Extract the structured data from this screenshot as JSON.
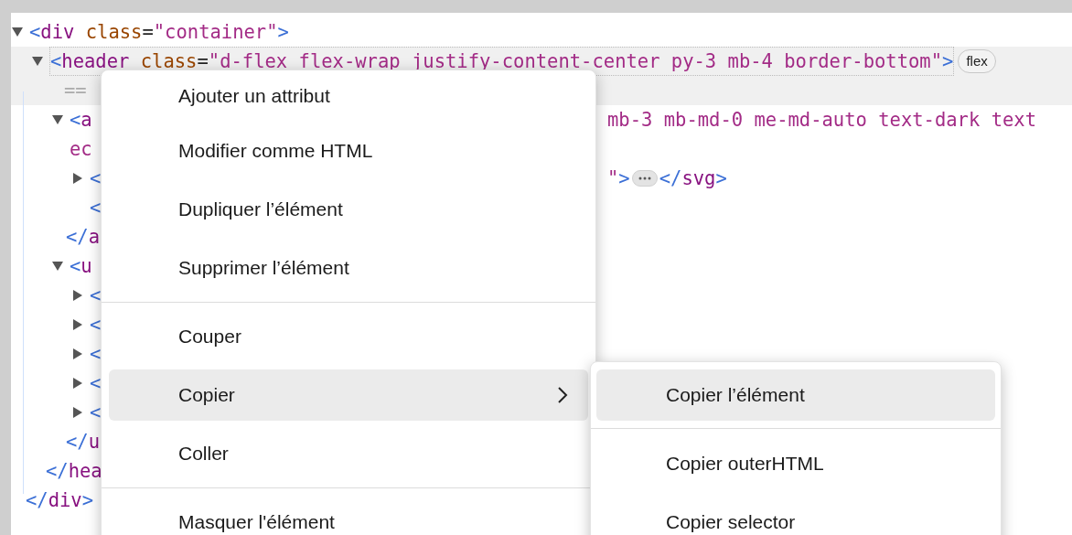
{
  "dom_tree": [
    {
      "expanded": true,
      "selected": false,
      "open": [
        {
          "kind": "bracket",
          "text": "<"
        },
        {
          "kind": "tag",
          "text": "div"
        },
        {
          "kind": "attr",
          "text": " class"
        },
        {
          "kind": "plain",
          "text": "="
        },
        {
          "kind": "value",
          "text": "\"container\""
        },
        {
          "kind": "bracket",
          "text": ">"
        }
      ],
      "close": [
        {
          "kind": "bracket",
          "text": "</"
        },
        {
          "kind": "tag",
          "text": "div"
        },
        {
          "kind": "bracket",
          "text": ">"
        }
      ],
      "children": [
        {
          "expanded": true,
          "selected": true,
          "badge": "flex",
          "marker": "==",
          "open": [
            {
              "kind": "bracket",
              "text": "<"
            },
            {
              "kind": "tag",
              "text": "header"
            },
            {
              "kind": "attr",
              "text": " class"
            },
            {
              "kind": "plain",
              "text": "="
            },
            {
              "kind": "value",
              "text": "\"d-flex flex-wrap justify-content-center py-3 mb-4 border-bottom\""
            },
            {
              "kind": "bracket",
              "text": ">"
            }
          ],
          "close": [
            {
              "kind": "bracket",
              "text": "</"
            },
            {
              "kind": "tag",
              "text": "hea"
            }
          ],
          "children": [
            {
              "expanded": true,
              "selected": false,
              "open": [
                {
                  "kind": "bracket",
                  "text": "<"
                },
                {
                  "kind": "tag",
                  "text": "a"
                }
              ],
              "right": [
                {
                  "kind": "value",
                  "text": "mb-3 mb-md-0 me-md-auto text-dark text"
                }
              ],
              "continuation": [
                {
                  "kind": "value",
                  "text": "ec"
                }
              ],
              "close": [
                {
                  "kind": "bracket",
                  "text": "</"
                },
                {
                  "kind": "tag",
                  "text": "a"
                }
              ],
              "children": [
                {
                  "expanded": false,
                  "selected": false,
                  "open": [
                    {
                      "kind": "bracket",
                      "text": "<"
                    }
                  ],
                  "right": [
                    {
                      "kind": "value",
                      "text": "\""
                    },
                    {
                      "kind": "bracket",
                      "text": ">"
                    },
                    {
                      "kind": "ellipsis"
                    },
                    {
                      "kind": "bracket",
                      "text": "</"
                    },
                    {
                      "kind": "tag",
                      "text": "svg"
                    },
                    {
                      "kind": "bracket",
                      "text": ">"
                    }
                  ]
                },
                {
                  "selected": false,
                  "open": [
                    {
                      "kind": "bracket",
                      "text": "<"
                    }
                  ]
                }
              ]
            },
            {
              "expanded": true,
              "selected": false,
              "open": [
                {
                  "kind": "bracket",
                  "text": "<"
                },
                {
                  "kind": "tag",
                  "text": "u"
                }
              ],
              "close": [
                {
                  "kind": "bracket",
                  "text": "</"
                },
                {
                  "kind": "tag",
                  "text": "u"
                }
              ],
              "children": [
                {
                  "expanded": false,
                  "selected": false,
                  "open": [
                    {
                      "kind": "bracket",
                      "text": "<"
                    }
                  ]
                },
                {
                  "expanded": false,
                  "selected": false,
                  "open": [
                    {
                      "kind": "bracket",
                      "text": "<"
                    }
                  ]
                },
                {
                  "expanded": false,
                  "selected": false,
                  "open": [
                    {
                      "kind": "bracket",
                      "text": "<"
                    }
                  ]
                },
                {
                  "expanded": false,
                  "selected": false,
                  "open": [
                    {
                      "kind": "bracket",
                      "text": "<"
                    }
                  ]
                },
                {
                  "expanded": false,
                  "selected": false,
                  "open": [
                    {
                      "kind": "bracket",
                      "text": "<"
                    }
                  ]
                }
              ]
            }
          ]
        }
      ]
    }
  ],
  "context_menu": {
    "items": [
      {
        "kind": "item",
        "label": "Ajouter un attribut",
        "selected": false,
        "submenu": false
      },
      {
        "kind": "item",
        "label": "Modifier comme HTML",
        "selected": false,
        "submenu": false
      },
      {
        "kind": "item",
        "label": "Dupliquer l’élément",
        "selected": false,
        "submenu": false
      },
      {
        "kind": "item",
        "label": "Supprimer l’élément",
        "selected": false,
        "submenu": false
      },
      {
        "kind": "separator"
      },
      {
        "kind": "item",
        "label": "Couper",
        "selected": false,
        "submenu": false
      },
      {
        "kind": "item",
        "label": "Copier",
        "selected": true,
        "submenu": true
      },
      {
        "kind": "item",
        "label": "Coller",
        "selected": false,
        "submenu": false
      },
      {
        "kind": "separator"
      },
      {
        "kind": "item",
        "label": "Masquer l'élément",
        "selected": false,
        "submenu": false
      }
    ]
  },
  "submenu": {
    "items": [
      {
        "kind": "item",
        "label": "Copier l’élément",
        "selected": true
      },
      {
        "kind": "separator"
      },
      {
        "kind": "item",
        "label": "Copier outerHTML",
        "selected": false
      },
      {
        "kind": "item",
        "label": "Copier selector",
        "selected": false
      }
    ]
  }
}
